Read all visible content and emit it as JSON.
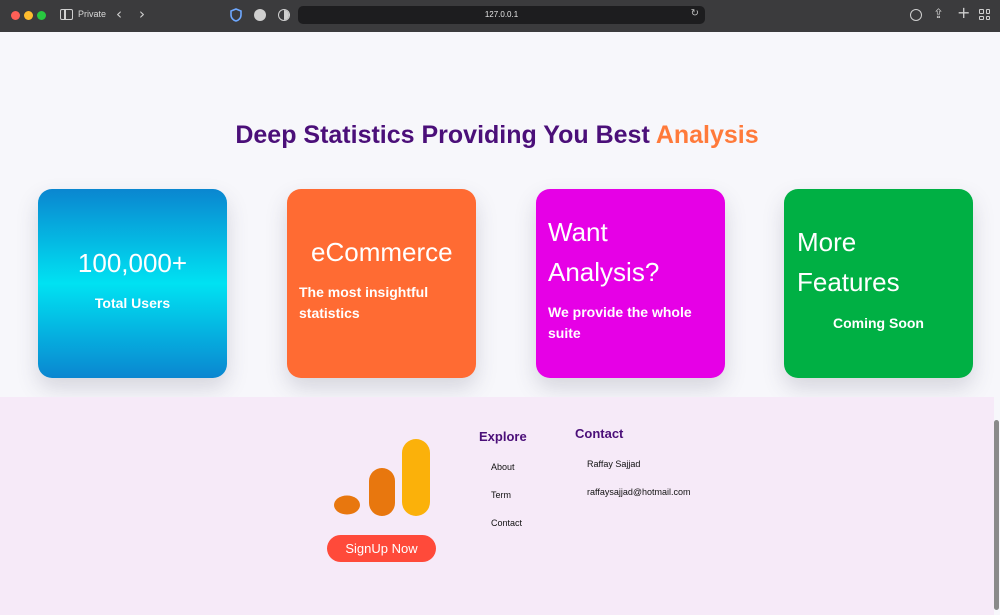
{
  "browser": {
    "private_label": "Private",
    "url": "127.0.0.1"
  },
  "stats": {
    "headline_main": "Deep Statistics Providing You Best ",
    "headline_accent": "Analysis",
    "cards": [
      {
        "big": "100,000+",
        "sub": "Total Users"
      },
      {
        "big": "eCommerce",
        "sub": "The most insightful statistics"
      },
      {
        "big": "Want Analysis?",
        "sub": "We provide the whole suite"
      },
      {
        "big": "More Features",
        "sub": "Coming Soon"
      }
    ]
  },
  "footer": {
    "signup_label": "SignUp Now",
    "explore": {
      "title": "Explore",
      "links": [
        "About",
        "Term",
        "Contact"
      ]
    },
    "contact": {
      "title": "Contact",
      "name": "Raffay Sajjad",
      "email": "raffaysajjad@hotmail.com"
    }
  },
  "colors": {
    "headline": "#4b0f79",
    "accent": "#ff7a3a",
    "users_card": "#0a86d0",
    "ecommerce_card": "#ff6b33",
    "analysis_card": "#e600e6",
    "features_card": "#00b044",
    "signup_button": "#ff4a3a",
    "footer_bg": "#f6eaf8"
  }
}
